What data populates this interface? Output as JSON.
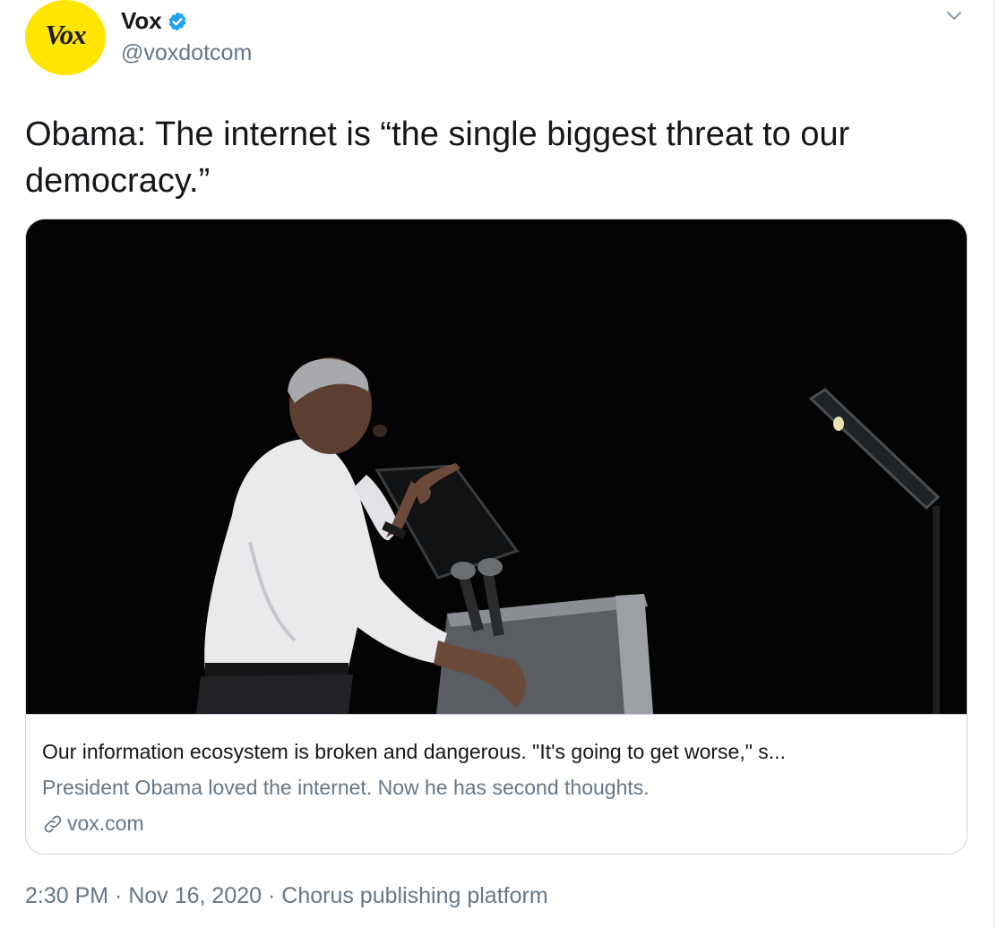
{
  "author": {
    "avatar_text": "Vox",
    "display_name": "Vox",
    "handle": "@voxdotcom",
    "verified": true,
    "avatar_color": "#ffe500"
  },
  "tweet": {
    "text": "Obama: The internet is “the single biggest threat to our democracy.”"
  },
  "card": {
    "title": "Our information ecosystem is broken and dangerous. \"It's going to get worse,\" s...",
    "description": "President Obama loved the internet. Now he has second thoughts.",
    "domain": "vox.com"
  },
  "meta": {
    "time": "2:30 PM",
    "separator": " · ",
    "date": "Nov 16, 2020",
    "source": "Chorus publishing platform"
  },
  "colors": {
    "verified_blue": "#1da1f2",
    "secondary_text": "#657786",
    "border": "#ccd6dd"
  },
  "icons": [
    "verified-badge-icon",
    "chevron-down-icon",
    "link-icon"
  ]
}
